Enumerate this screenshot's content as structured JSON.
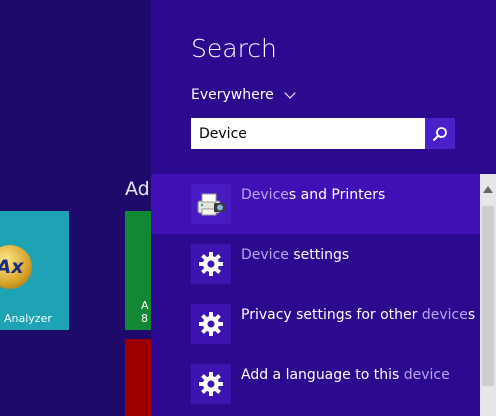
{
  "start_screen": {
    "group_label": "Ad",
    "tiles": [
      {
        "name": "Analyzer",
        "logo_text": "Ax",
        "color": "#1ea3b5"
      },
      {
        "text_line1": "A",
        "text_line2": "8",
        "color": "#128834"
      },
      {
        "color": "#9c0000"
      }
    ]
  },
  "search": {
    "title": "Search",
    "scope": "Everywhere",
    "query": "Device",
    "results": [
      {
        "icon": "devices-and-printers-icon",
        "highlight": "Device",
        "rest": "s and Printers",
        "selected": true
      },
      {
        "icon": "gear-icon",
        "highlight": "Device",
        "rest": " settings"
      },
      {
        "icon": "gear-icon",
        "prefix": "Privacy settings for other ",
        "highlight": "device",
        "suffix": "s"
      },
      {
        "icon": "gear-icon",
        "prefix": "Add a language to this ",
        "highlight": "device"
      }
    ]
  },
  "colors": {
    "panel": "#2b0a8f",
    "selected": "#4110b5",
    "accent": "#4a21c8"
  }
}
